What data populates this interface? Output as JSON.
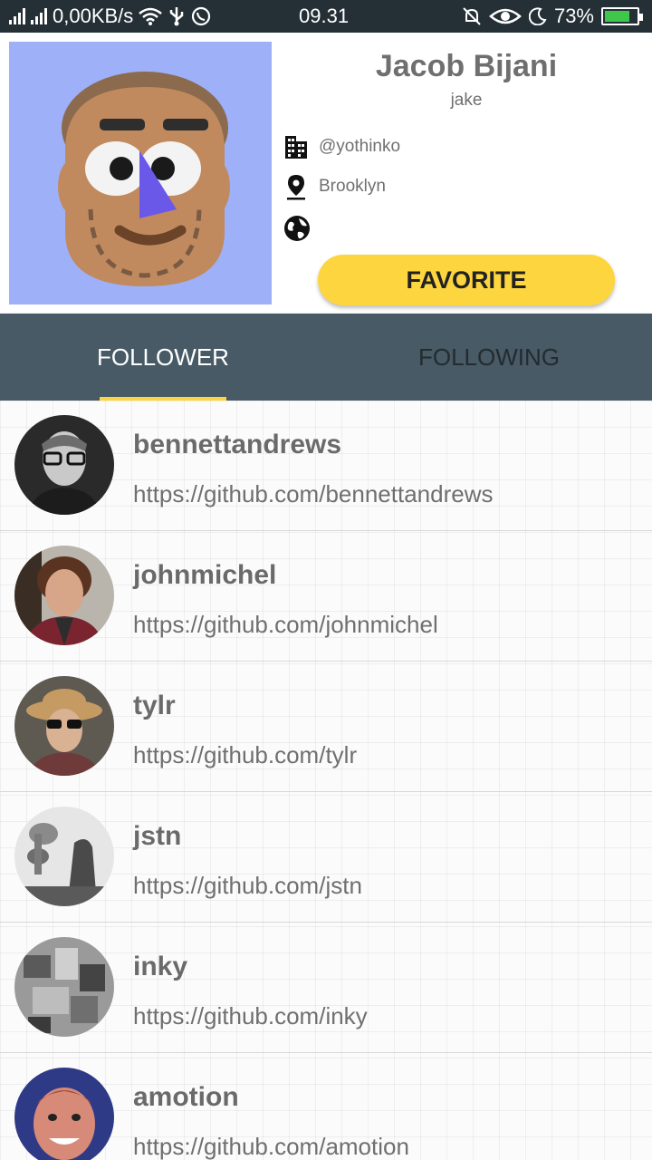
{
  "status_bar": {
    "speed": "0,00KB/s",
    "time": "09.31",
    "battery": "73%",
    "battery_level": 0.73
  },
  "profile": {
    "name": "Jacob Bijani",
    "login": "jake",
    "company": "@yothinko",
    "location": "Brooklyn",
    "blog": "",
    "favorite_label": "FAVORITE",
    "icons": [
      "building-icon",
      "location-pin-icon",
      "globe-icon"
    ]
  },
  "tabs": [
    {
      "label": "FOLLOWER",
      "active": true
    },
    {
      "label": "FOLLOWING",
      "active": false
    }
  ],
  "followers": [
    {
      "login": "bennettandrews",
      "url": "https://github.com/bennettandrews"
    },
    {
      "login": "johnmichel",
      "url": "https://github.com/johnmichel"
    },
    {
      "login": "tylr",
      "url": "https://github.com/tylr"
    },
    {
      "login": "jstn",
      "url": "https://github.com/jstn"
    },
    {
      "login": "inky",
      "url": "https://github.com/inky"
    },
    {
      "login": "amotion",
      "url": "https://github.com/amotion"
    }
  ],
  "colors": {
    "status_bar": "#243036",
    "tab_bar": "#475a65",
    "accent": "#fdd53e",
    "avatar_bg": "#9eb0f8"
  }
}
